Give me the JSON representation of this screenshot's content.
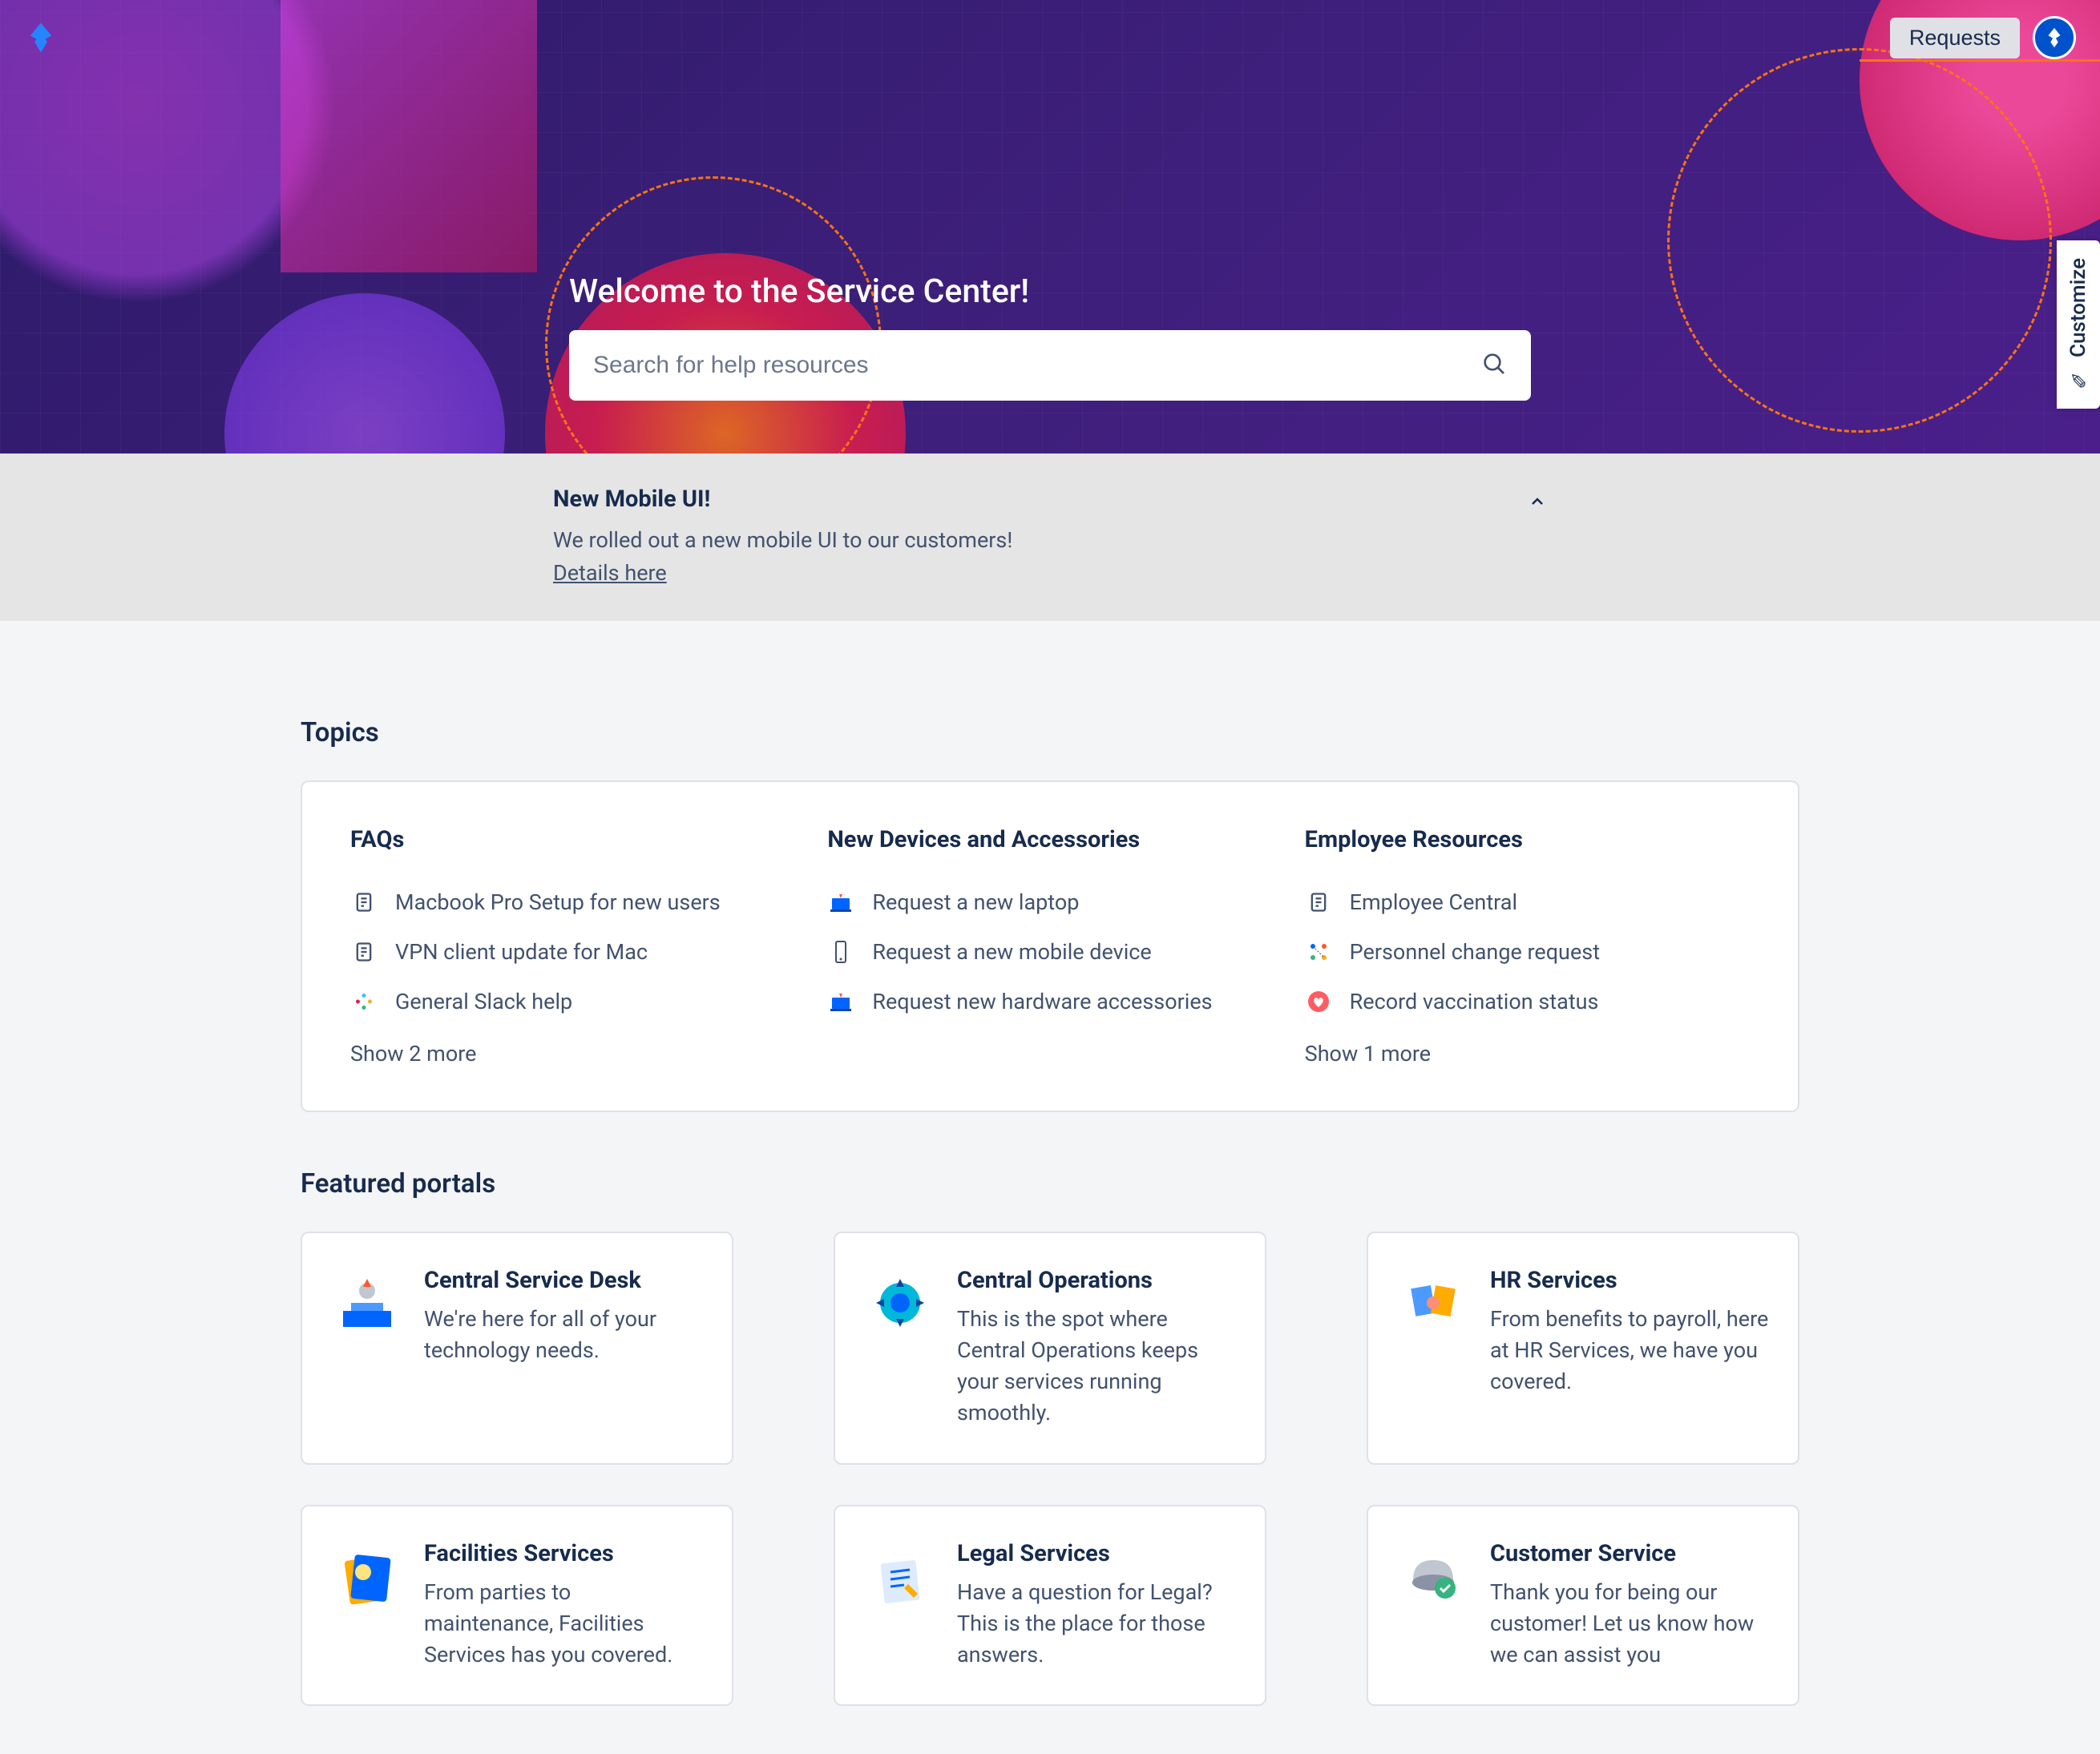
{
  "header": {
    "requests_label": "Requests"
  },
  "hero": {
    "title": "Welcome to the Service Center!",
    "search_placeholder": "Search for help resources"
  },
  "customize_label": "Customize",
  "announcement": {
    "title": "New Mobile UI!",
    "body": "We rolled out a new mobile UI to our customers!",
    "link_text": "Details here"
  },
  "topics": {
    "section_title": "Topics",
    "columns": [
      {
        "heading": "FAQs",
        "items": [
          {
            "icon": "document",
            "label": "Macbook Pro Setup for new users"
          },
          {
            "icon": "document",
            "label": "VPN client update for Mac"
          },
          {
            "icon": "slack",
            "label": "General Slack help"
          }
        ],
        "show_more": "Show 2 more"
      },
      {
        "heading": "New Devices and Accessories",
        "items": [
          {
            "icon": "laptop",
            "label": "Request a new laptop"
          },
          {
            "icon": "phone",
            "label": "Request a new mobile device"
          },
          {
            "icon": "laptop",
            "label": "Request new hardware accessories"
          }
        ],
        "show_more": ""
      },
      {
        "heading": "Employee Resources",
        "items": [
          {
            "icon": "document",
            "label": "Employee Central"
          },
          {
            "icon": "dots",
            "label": "Personnel change request"
          },
          {
            "icon": "heart",
            "label": "Record vaccination status"
          }
        ],
        "show_more": "Show 1 more"
      }
    ]
  },
  "portals": {
    "section_title": "Featured portals",
    "cards": [
      {
        "icon": "csd",
        "title": "Central Service Desk",
        "desc": "We're here for all of your technology needs."
      },
      {
        "icon": "cops",
        "title": "Central Operations",
        "desc": "This is the spot where Central Operations keeps your services running smoothly."
      },
      {
        "icon": "hr",
        "title": "HR Services",
        "desc": "From benefits to payroll, here at HR Services, we have you covered."
      },
      {
        "icon": "fac",
        "title": "Facilities Services",
        "desc": "From parties to maintenance, Facilities Services has you covered."
      },
      {
        "icon": "legal",
        "title": "Legal Services",
        "desc": "Have a question for Legal? This is the place for those answers."
      },
      {
        "icon": "cust",
        "title": "Customer Service",
        "desc": "Thank you for being our customer! Let us know how we can assist you"
      }
    ]
  }
}
